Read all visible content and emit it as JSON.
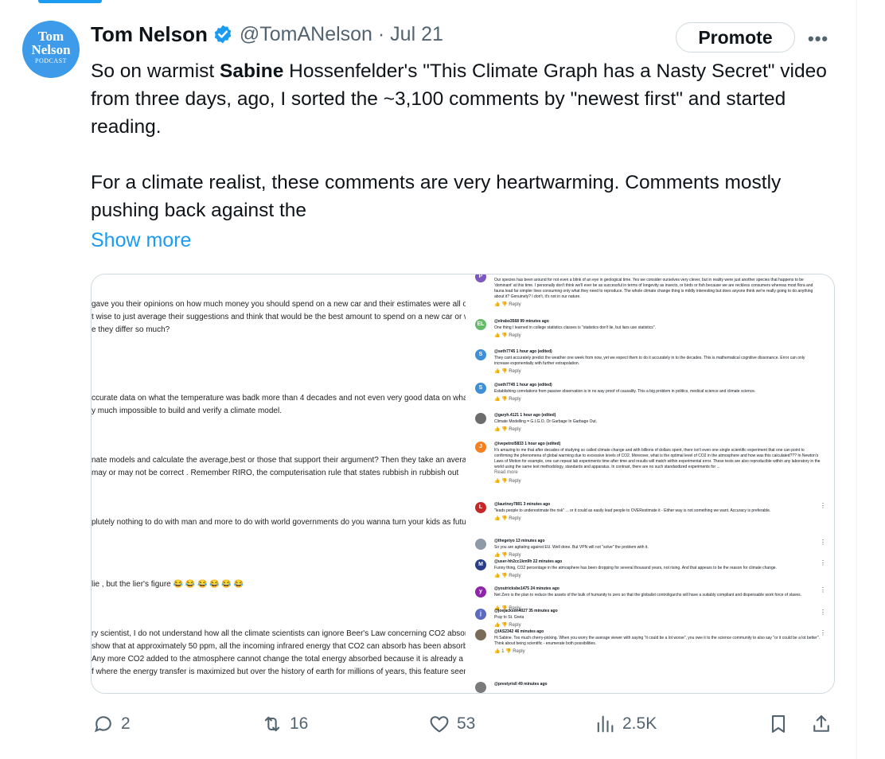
{
  "tweet": {
    "avatar": {
      "line1": "Tom",
      "line2": "Nelson",
      "line3": "PODCAST"
    },
    "author_name": "Tom Nelson",
    "handle_date": "@TomANelson · Jul 21",
    "promote_label": "Promote",
    "more_label": "•••",
    "text_part1": "So on warmist ",
    "text_bold": "Sabine",
    "text_part2": " Hossenfelder's \"This Climate Graph has a Nasty Secret\" video from three days, ago, I sorted the ~3,100 comments by \"newest first\" and started reading.",
    "text_para2": "For a climate realist, these comments are very heartwarming. Comments mostly pushing back against the",
    "show_more": "Show more"
  },
  "media": {
    "left_lines": [
      "gave you their opinions on how much money you should spend on a new car and their estimates were all over t",
      "t wise to just average their suggestions and think that would be the best amount to spend on a new car or woulc",
      "e they differ so much?",
      "ccurate data on what the temperature was badk more than 4 decades and not even very good data on what the t",
      "y much impossible to build and verify a climate model.",
      "nate models and calculate the average,best or those that support their argument? Then they take an average of",
      "may or may not be correct .  Remember RIRO, the computerisation rule that states rubbish in rubbish out",
      "plutely nothing to do with man and more to do with world governments do you wanna turn your kids as future int",
      "lie , but the lier's figure 😂 😂 😂 😂 😂 😂",
      "ry scientist, I do not understand how all the climate scientists can ignore Beer's Law concerning CO2 absorptior",
      " show that at approximately 50 ppm, all the incoming infrared energy that CO2 can absorb has been absorbed.",
      "Any more CO2 added to the atmosphere cannot change the total energy absorbed because it is already a",
      "f where the energy transfer is maximized but over the history of earth for millions of years, this feature seems tc"
    ],
    "comments": [
      {
        "initial": "P",
        "color": "#7e57c2",
        "handle": "",
        "text": "Our species has been around for not even a blink of an eye in geological time. Yes we consider ourselves very clever, but in reality were just another species that happens to be 'dominant' at this time. I personally don't think we'll ever be as successful in terms of longevity as insects, or birds or fish because we are reckless consumers whereas most flora and fauna lead far simpler lives consuming only what they need to reproduce. The whole climate change thing is mildly interesting but does anyone think we're really going to do anything about it? Genuinely? I don't, it's not in our nature.",
        "actions": "👍 👎   Reply"
      },
      {
        "initial": "EL",
        "color": "#66bb6a",
        "handle": "@elrabo3568  99 minutes ago",
        "text": "One thing I learned in college statistics classes is \"statistics don't lie, but liars use statistics\".",
        "actions": "👍 👎   Reply"
      },
      {
        "initial": "S",
        "color": "#3f8fd8",
        "handle": "@seth7745  1 hour ago (edited)",
        "text": "They cant accurately predict the weather one week from now, yet we expect them to do it accurately in to the decades. This is mathematical cognitive dissonance. Error can only increase exponentially with further extrapolation.",
        "actions": "👍 👎   Reply"
      },
      {
        "initial": "S",
        "color": "#3f8fd8",
        "handle": "@seth7745  1 hour ago (edited)",
        "text": "Establishing correlations from passive observation is in no way proof of causality. This a big problem in politics, medical science and climate science.",
        "actions": "👍 👎   Reply"
      },
      {
        "initial": "",
        "color": "#6d6d6d",
        "handle": "@garyh.4121  1 hour ago (edited)",
        "text": "Climate Modelling = G.I.G.O.  Or Garbage In Garbage Out.",
        "actions": "👍 👎   Reply"
      },
      {
        "initial": "J",
        "color": "#f4801f",
        "handle": "@ivepetrol5833  1 hour ago (edited)",
        "text": "It's amazing to me that after decades of studying so called climate change and with billions of dollars spent, there isn't even one single scientific experiment that one can point to confirming the phenomena of global warming due to excessive levels of CO2.  Moreover, what is the optimal level of CO2 in the atmosphere and how was this calculated??? In Newton's Laws of Motion for example, one can repeat lab experiments time after time and results will match within experimental error. These tests are also reproducible within any laboratory in the world using the same text methodology, standards and apparatus.  In contrast, there are no such standardized experiments for ...",
        "more": "Read more",
        "actions": "👍 👎   Reply"
      },
      {
        "initial": "L",
        "color": "#c62828",
        "handle": "@lauriney7801  3 minutes ago",
        "text": "\"leads people to underestimate the risk\" ... or it could as easily lead people to OVERestimate it - Either way is not something we want.  Accuracy is preferable.",
        "actions": "👍 👎   Reply"
      },
      {
        "initial": "",
        "color": "#8e9aa6",
        "handle": "@thegetyo  13 minutes ago",
        "text": "So you are agitating against EU. Well done. But VPN will not \"solve\" the problem with it.",
        "actions": "👍 👎   Reply"
      },
      {
        "initial": "M",
        "color": "#283e8c",
        "handle": "@user-hh2cc1km9h  22 minutes ago",
        "text": "Funny thing, CO2 percentage in the atmosphere has been dropping for several thousand years, not rising. And that appears to be the reason for climate change.",
        "actions": "👍 👎   Reply"
      },
      {
        "initial": "y",
        "color": "#8e24aa",
        "handle": "@youtricksbe1475  24 minutes ago",
        "text": "Net Zero is the plan to reduce the assets of the bulk of humanity to zero so that the globalist controligarchs will have a suitably compliant and dispensable work force of slaves.",
        "actions": "👍 👎   Reply"
      },
      {
        "initial": "j",
        "color": "#5c6bc0",
        "handle": "@joejackson4027  35 minutes ago",
        "text": "Pray to St. Greta",
        "actions": "👍 👎   Reply"
      },
      {
        "initial": "",
        "color": "#7a6a58",
        "handle": "@IAS2342  46 minutes ago",
        "text": "Hi Sabine. Too much cherry-picking. When you worry the average viewer with saying \"it could be a lot worse\", you owe it to the science community to also say \"or it could be a lot better\". Think about being scientific - enumerate both possibilities.",
        "actions": "👍 1  👎   Reply"
      },
      {
        "initial": "",
        "color": "#7a7a7a",
        "handle": "@prestyrisll  49 minutes ago",
        "text": "",
        "actions": ""
      }
    ]
  },
  "actions": {
    "replies": "2",
    "reposts": "16",
    "likes": "53",
    "views": "2.5K"
  },
  "colors": {
    "accent": "#1d9bf0",
    "muted": "#536471",
    "border": "#cfd9de"
  }
}
